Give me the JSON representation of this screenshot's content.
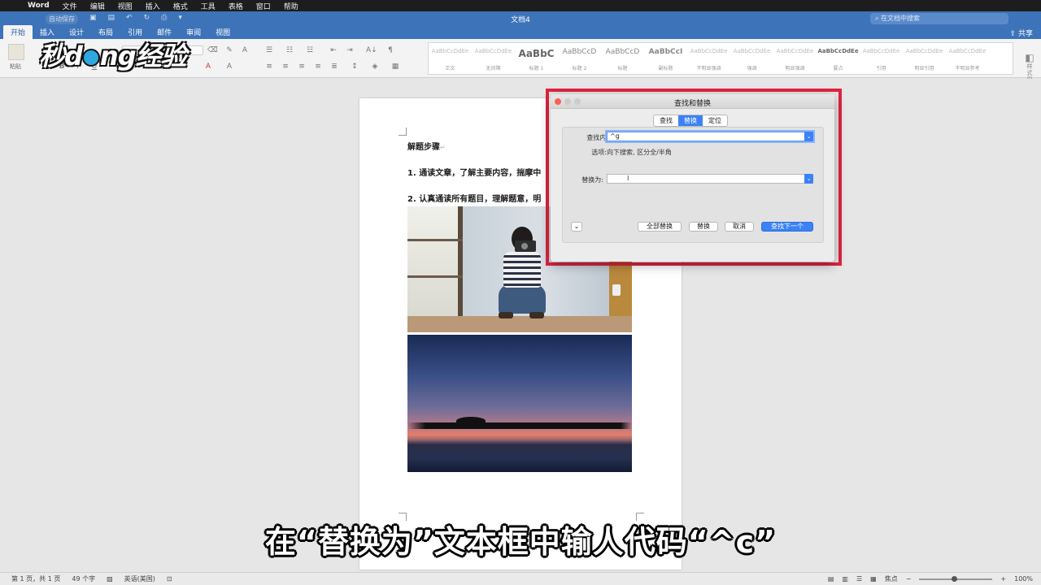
{
  "menubar": {
    "app_name": "Word",
    "items": [
      "文件",
      "编辑",
      "视图",
      "插入",
      "格式",
      "工具",
      "表格",
      "窗口",
      "帮助"
    ]
  },
  "titlebar": {
    "doc_title": "文档4",
    "autosave": "自动保存",
    "search_placeholder": "在文档中搜索"
  },
  "ribbon": {
    "tabs": [
      "开始",
      "插入",
      "设计",
      "布局",
      "引用",
      "邮件",
      "审阅",
      "视图"
    ],
    "active_tab": 0,
    "share_label": "共享",
    "paste_label": "粘贴",
    "styles_pane_label": "样式窗格",
    "styles": [
      {
        "sample": "AaBbCcDdEe",
        "name": "正文"
      },
      {
        "sample": "AaBbCcDdEe",
        "name": "无间隔"
      },
      {
        "sample": "AaBbC",
        "name": "标题 1"
      },
      {
        "sample": "AaBbCcD",
        "name": "标题 2"
      },
      {
        "sample": "AaBbCcD",
        "name": "标题"
      },
      {
        "sample": "AaBbCcI",
        "name": "副标题"
      },
      {
        "sample": "AaBbCcDdEe",
        "name": "不明显强调"
      },
      {
        "sample": "AaBbCcDdEe",
        "name": "强调"
      },
      {
        "sample": "AaBbCcDdEe",
        "name": "明显强调"
      },
      {
        "sample": "AaBbCcDdEe",
        "name": "要点"
      },
      {
        "sample": "AaBbCcDdEe",
        "name": "引用"
      },
      {
        "sample": "AaBbCcDdEe",
        "name": "明显引用"
      },
      {
        "sample": "AaBbCcDdEe",
        "name": "不明显参考"
      }
    ]
  },
  "document": {
    "heading": "解题步骤",
    "line1": "1.  通读文章，了解主要内容，揣摩中",
    "line2": "2.  认真通读所有题目，理解题意，明"
  },
  "dialog": {
    "title": "查找和替换",
    "tabs": [
      "查找",
      "替换",
      "定位"
    ],
    "active_tab": 1,
    "find_label": "查找内容:",
    "find_value": "^g",
    "options_label": "选项:",
    "options_value": "向下搜索, 区分全/半角",
    "replace_label": "替换为:",
    "replace_value": "",
    "buttons": {
      "replace_all": "全部替换",
      "replace": "替换",
      "cancel": "取消",
      "find_next": "查找下一个"
    },
    "expand_icon": "chevron-down-icon"
  },
  "subtitle": "在“替换为”文本框中输人代码“^c”",
  "watermark": "秒懂经验",
  "statusbar": {
    "page": "第 1 页，共 1 页",
    "words": "49 个字",
    "language": "英语(美国)",
    "focus": "焦点",
    "zoom": "100%"
  },
  "colors": {
    "accent": "#3d73b8",
    "dialog_primary": "#3b82f6",
    "highlight": "#e0233f"
  }
}
